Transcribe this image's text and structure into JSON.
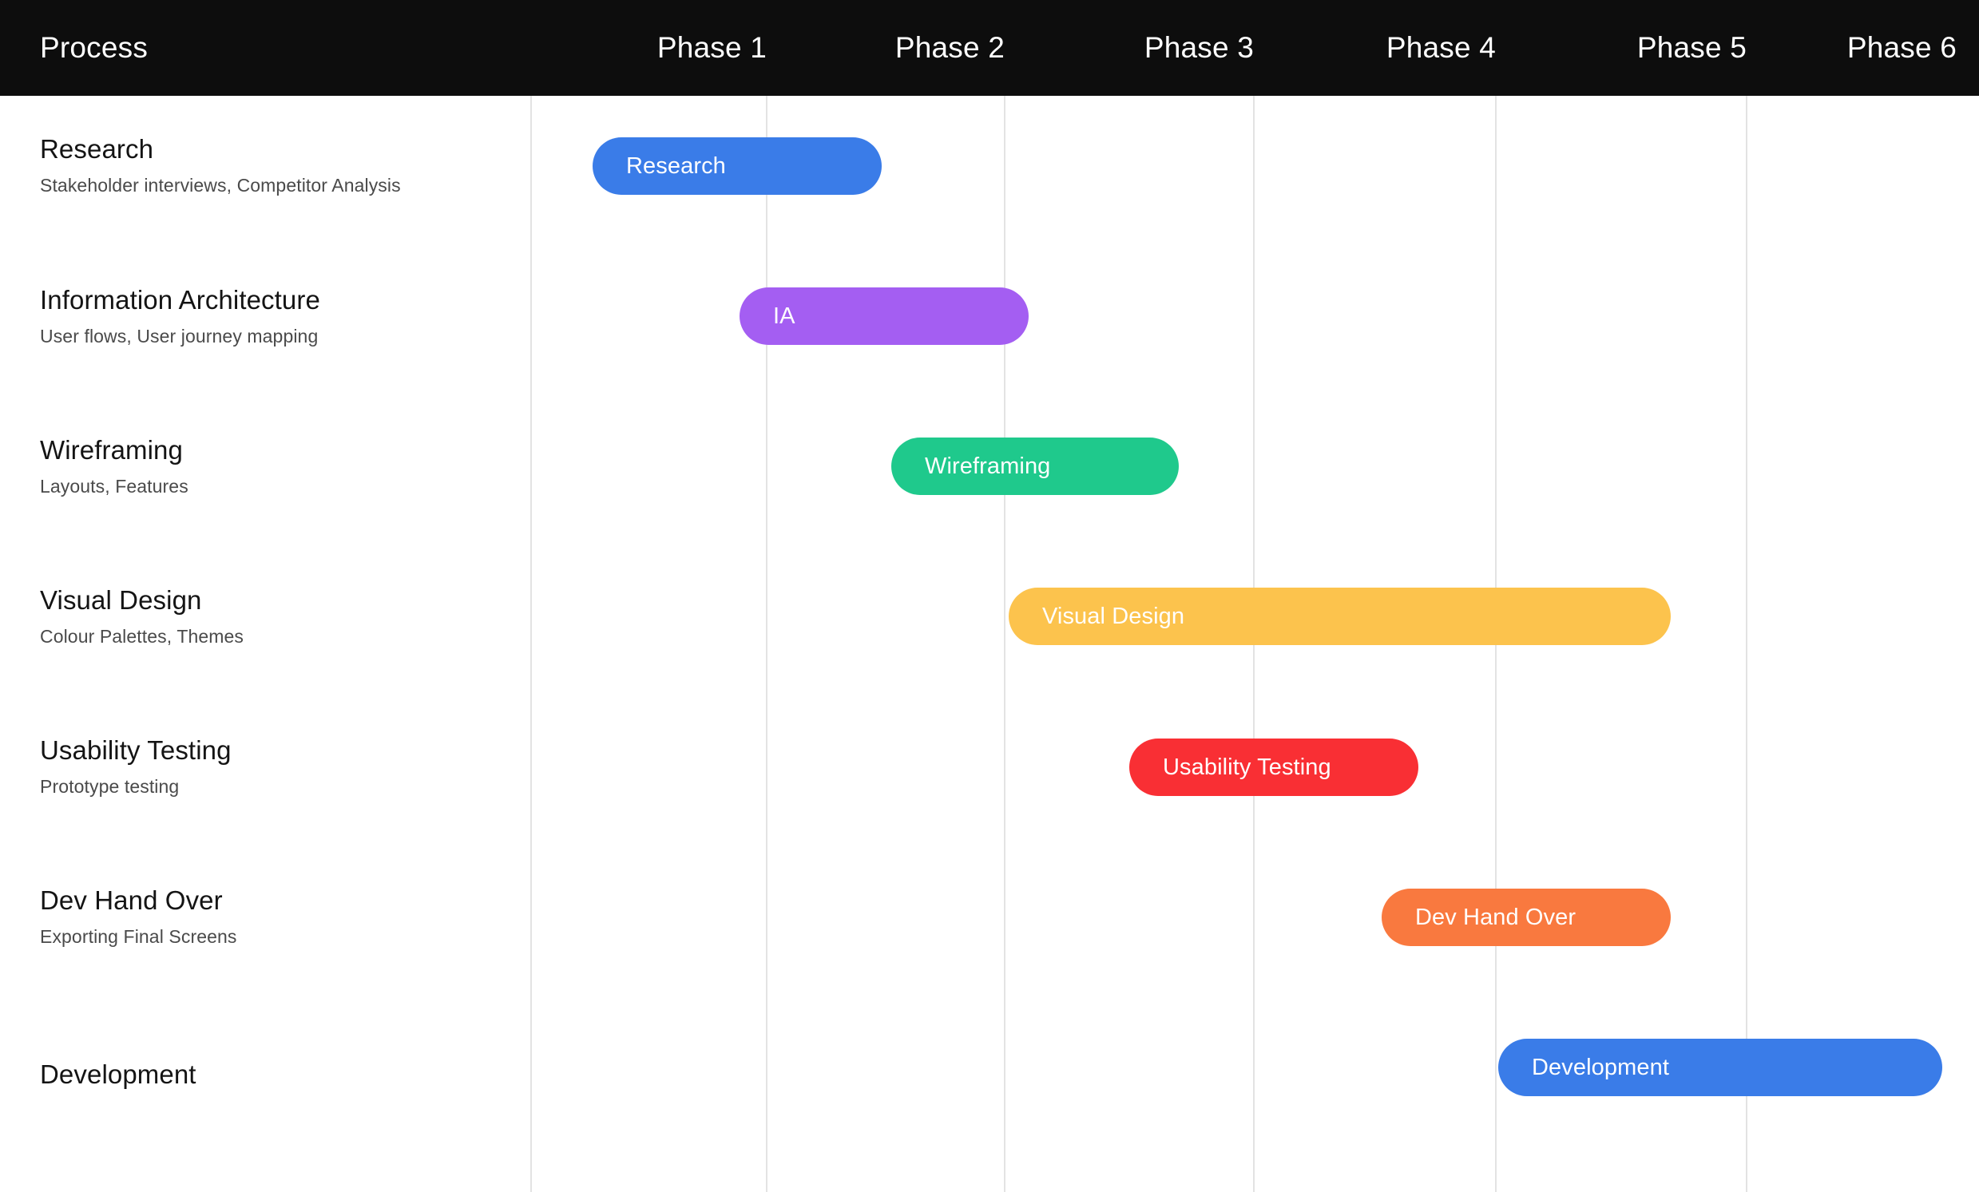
{
  "header": {
    "process_label": "Process",
    "background_color": "#0d0d0d",
    "phases": [
      {
        "label": "Phase 1"
      },
      {
        "label": "Phase 2"
      },
      {
        "label": "Phase 3"
      },
      {
        "label": "Phase 4"
      },
      {
        "label": "Phase 5"
      },
      {
        "label": "Phase 6"
      }
    ]
  },
  "chart_data": {
    "type": "bar",
    "title": "Process",
    "xlabel": "",
    "ylabel": "",
    "grid": true,
    "legend_position": "none",
    "categories": [
      "Research",
      "Information Architecture",
      "Wireframing",
      "Visual Design",
      "Usability Testing",
      "Dev Hand Over",
      "Development"
    ],
    "x_tick_labels": [
      "Phase 1",
      "Phase 2",
      "Phase 3",
      "Phase 4",
      "Phase 5",
      "Phase 6"
    ],
    "xlim": [
      0,
      6
    ],
    "tasks": [
      {
        "name": "Research",
        "subtitle": "Stakeholder interviews, Competitor Analysis",
        "bar_label": "Research",
        "start_phase": 0.25,
        "end_phase": 1.48,
        "color": "#3a7ce8"
      },
      {
        "name": "Information Architecture",
        "subtitle": "User flows, User journey mapping",
        "bar_label": "IA",
        "start_phase": 0.88,
        "end_phase": 2.1,
        "color": "#a45ef2"
      },
      {
        "name": "Wireframing",
        "subtitle": "Layouts, Features",
        "bar_label": "Wireframing",
        "start_phase": 1.53,
        "end_phase": 2.74,
        "color": "#1fc98c"
      },
      {
        "name": "Visual Design",
        "subtitle": "Colour Palettes, Themes",
        "bar_label": "Visual Design",
        "start_phase": 2.03,
        "end_phase": 4.83,
        "color": "#fcc34d"
      },
      {
        "name": "Usability Testing",
        "subtitle": "Prototype testing",
        "bar_label": "Usability Testing",
        "start_phase": 2.54,
        "end_phase": 3.76,
        "color": "#f92f34"
      },
      {
        "name": "Dev Hand Over",
        "subtitle": "Exporting Final Screens",
        "bar_label": "Dev Hand Over",
        "start_phase": 3.61,
        "end_phase": 4.83,
        "color": "#f9793f"
      },
      {
        "name": "Development",
        "subtitle": "",
        "bar_label": "Development",
        "start_phase": 4.1,
        "end_phase": 5.98,
        "color": "#3a7ce8"
      }
    ]
  },
  "layout": {
    "gridline_color": "#e3e3e3",
    "label_color": "#141414",
    "sublabel_color": "#4a4a4a"
  }
}
